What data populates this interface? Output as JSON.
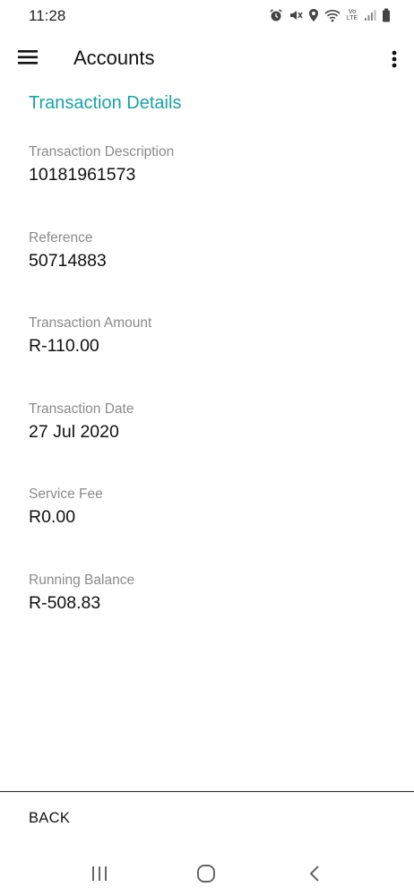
{
  "status_bar": {
    "time": "11:28",
    "icons": [
      "alarm-icon",
      "mute-icon",
      "location-icon",
      "wifi-icon",
      "volte-icon",
      "signal-icon",
      "battery-icon"
    ],
    "volte_text": "Vo LTE"
  },
  "app_bar": {
    "title": "Accounts",
    "menu_icon": "hamburger-menu-icon",
    "more_icon": "more-vert-icon"
  },
  "section": {
    "title": "Transaction Details"
  },
  "fields": [
    {
      "label": "Transaction Description",
      "value": "10181961573"
    },
    {
      "label": "Reference",
      "value": "50714883"
    },
    {
      "label": "Transaction Amount",
      "value": "R-110.00"
    },
    {
      "label": "Transaction Date",
      "value": "27 Jul 2020"
    },
    {
      "label": "Service Fee",
      "value": "R0.00"
    },
    {
      "label": "Running Balance",
      "value": "R-508.83"
    }
  ],
  "footer": {
    "back_label": "BACK"
  },
  "nav_bar": {
    "icons": [
      "recents-icon",
      "home-icon",
      "back-arrow-icon"
    ]
  },
  "colors": {
    "accent": "#17a2a9",
    "label": "#8a8a8a",
    "text": "#111111",
    "background": "#ffffff"
  }
}
